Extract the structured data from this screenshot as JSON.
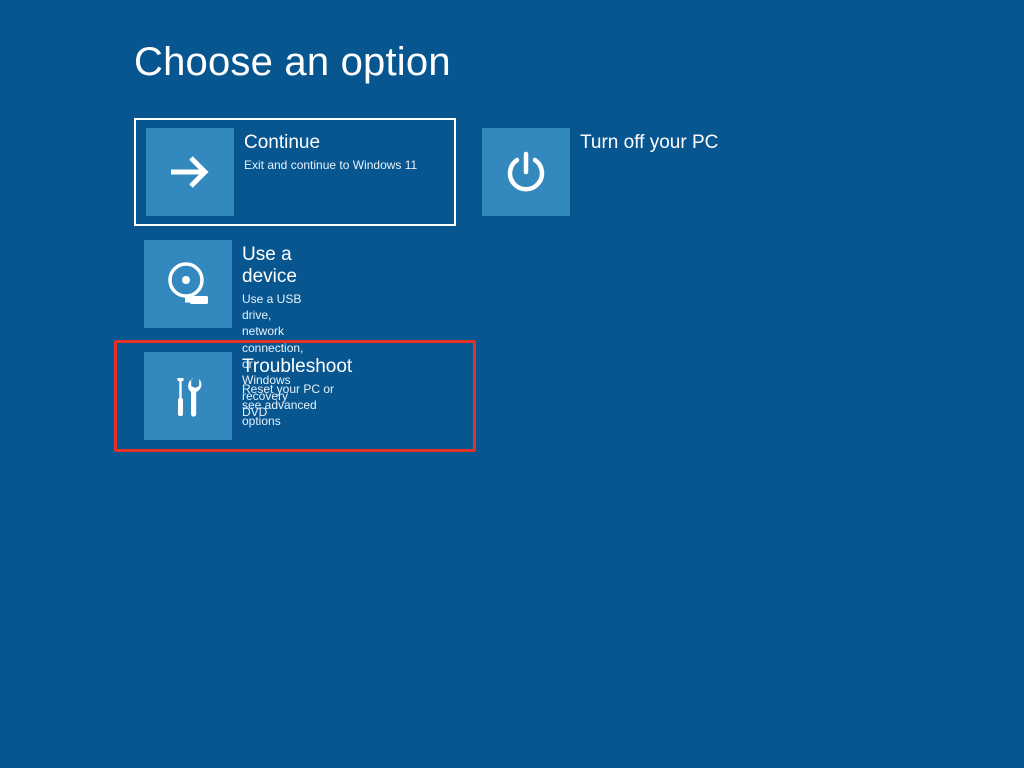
{
  "page": {
    "title": "Choose an option"
  },
  "tiles": {
    "continue": {
      "title": "Continue",
      "desc": "Exit and continue to Windows 11"
    },
    "poweroff": {
      "title": "Turn off your PC"
    },
    "device": {
      "title": "Use a device",
      "desc": "Use a USB drive, network connection, or Windows recovery DVD"
    },
    "troubleshoot": {
      "title": "Troubleshoot",
      "desc": "Reset your PC or see advanced options"
    }
  },
  "colors": {
    "bg": "#085690",
    "tile": "#3388bd",
    "highlight": "#e43228"
  }
}
